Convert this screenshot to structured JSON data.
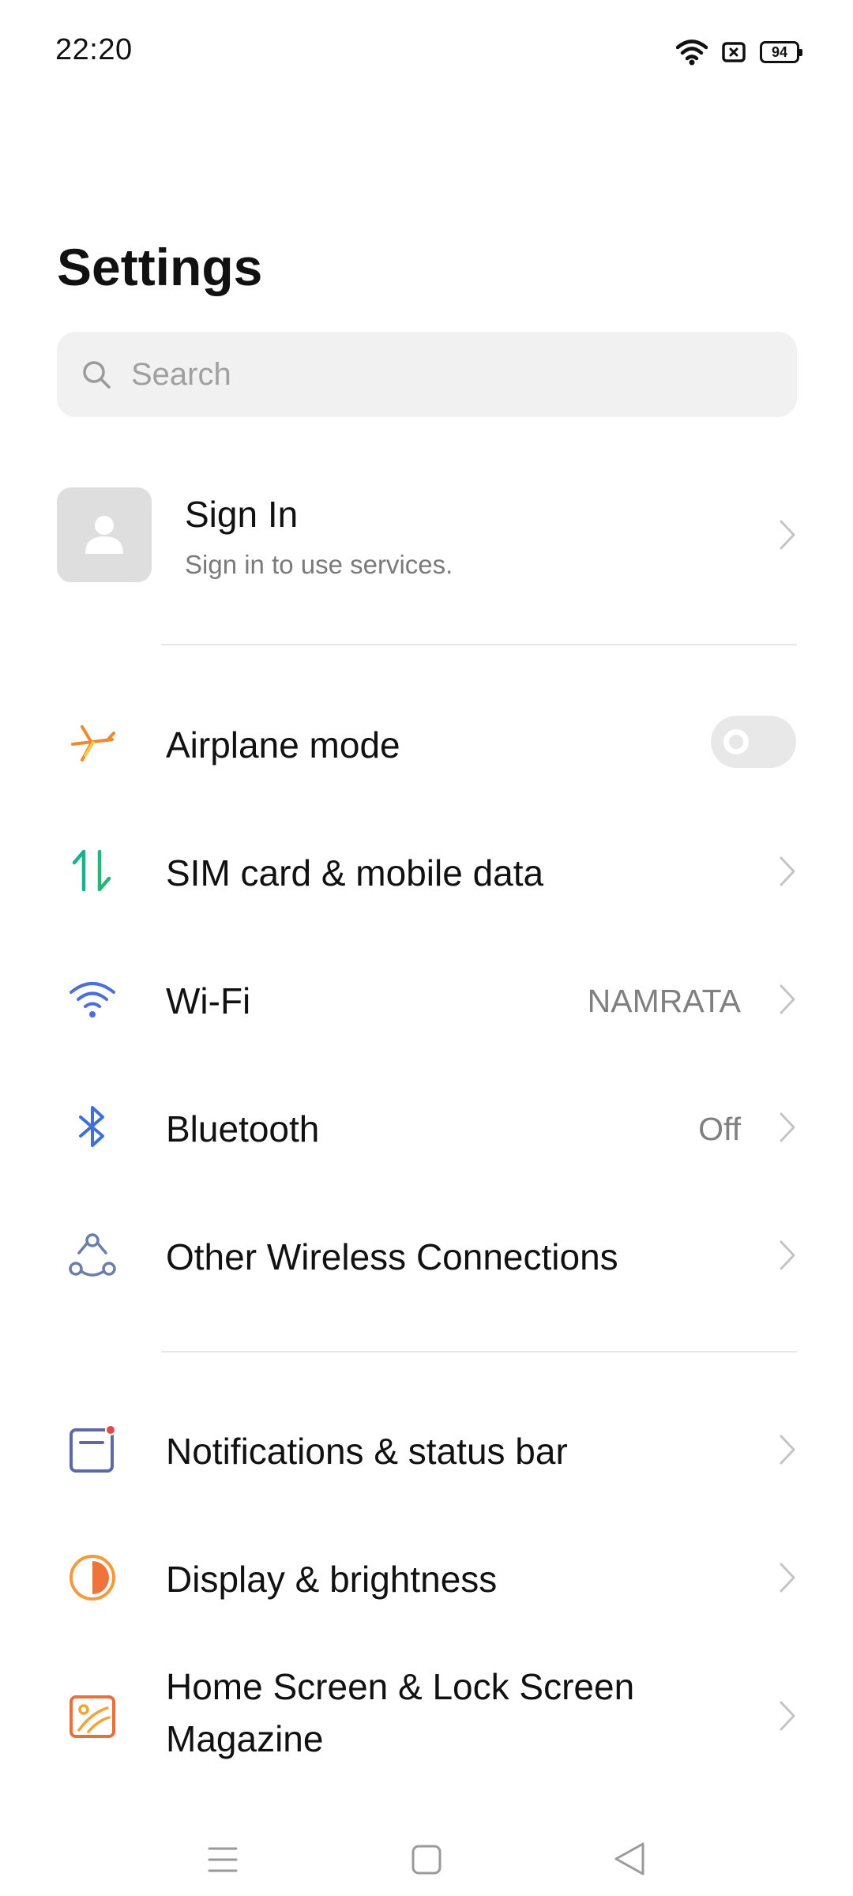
{
  "status_bar": {
    "time": "22:20",
    "battery_level": "94",
    "icons": [
      "wifi-icon",
      "sim-no-card-icon",
      "battery-icon"
    ]
  },
  "page": {
    "title": "Settings"
  },
  "search": {
    "placeholder": "Search",
    "value": ""
  },
  "account": {
    "title": "Sign In",
    "subtitle": "Sign in to use services."
  },
  "group1": [
    {
      "label": "Airplane mode",
      "icon": "airplane-icon",
      "toggle": false
    },
    {
      "label": "SIM card & mobile data",
      "icon": "mobile-data-icon"
    },
    {
      "label": "Wi-Fi",
      "icon": "wifi-icon",
      "value": "NAMRATA"
    },
    {
      "label": "Bluetooth",
      "icon": "bluetooth-icon",
      "value": "Off"
    },
    {
      "label": "Other Wireless Connections",
      "icon": "connections-icon"
    }
  ],
  "group2": [
    {
      "label": "Notifications & status bar",
      "icon": "notifications-icon"
    },
    {
      "label": "Display & brightness",
      "icon": "display-brightness-icon"
    },
    {
      "label": "Home Screen & Lock Screen Magazine",
      "icon": "wallpaper-icon"
    }
  ],
  "nav_bar": {
    "buttons": [
      "menu-icon",
      "home-icon",
      "back-icon"
    ]
  },
  "colors": {
    "airplane": "#f08a2e",
    "sim": "#1fae8e",
    "wifi": "#4a6fdc",
    "bluetooth": "#3f6fd8",
    "connections": "#6b7dab",
    "notifications": "#5b6aa6",
    "display": "#f59a3c",
    "wallpaper": "#e8703a"
  }
}
